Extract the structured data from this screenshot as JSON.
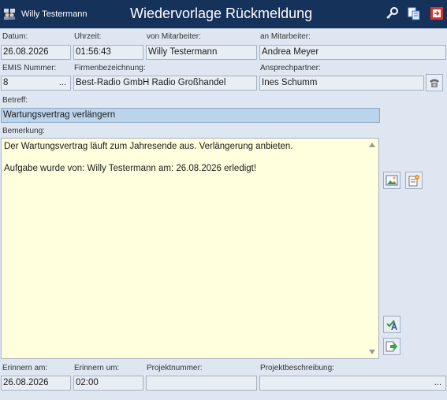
{
  "window": {
    "user": "Willy Testermann",
    "title": "Wiedervorlage Rückmeldung",
    "icons": [
      "user-icon",
      "search-key-icon",
      "copy-icon",
      "close-icon"
    ]
  },
  "labels": {
    "datum": "Datum:",
    "uhrzeit": "Uhrzeit:",
    "von_mitarbeiter": "von Mitarbeiter:",
    "an_mitarbeiter": "an Mitarbeiter:",
    "emis_nummer": "EMIS Nummer:",
    "firmenbezeichnung": "Firmenbezeichnung:",
    "ansprechpartner": "Ansprechpartner:",
    "betreff": "Betreff:",
    "bemerkung": "Bemerkung:",
    "erinnern_am": "Erinnern am:",
    "erinnern_um": "Erinnern um:",
    "projektnummer": "Projektnummer:",
    "projektbeschreibung": "Projektbeschreibung:"
  },
  "fields": {
    "datum": "26.08.2026",
    "uhrzeit": "01:56:43",
    "von_mitarbeiter": "Willy Testermann",
    "an_mitarbeiter": "Andrea Meyer",
    "emis_nummer": "8",
    "firmenbezeichnung": "Best-Radio GmbH Radio Großhandel",
    "ansprechpartner": "Ines Schumm",
    "betreff": "Wartungsvertrag verlängern",
    "bemerkung": "Der Wartungsvertrag läuft zum Jahresende aus. Verlängerung anbieten.\n\nAufgabe wurde von: Willy Testermann am: 26.08.2026 erledigt!",
    "erinnern_am": "26.08.2026",
    "erinnern_um": "02:00",
    "projektnummer": "",
    "projektbeschreibung": ""
  },
  "ellipsis": "...",
  "side_icons": [
    "phone-icon",
    "picture-icon",
    "edit-document-icon",
    "check-text-icon",
    "forward-arrow-icon"
  ]
}
